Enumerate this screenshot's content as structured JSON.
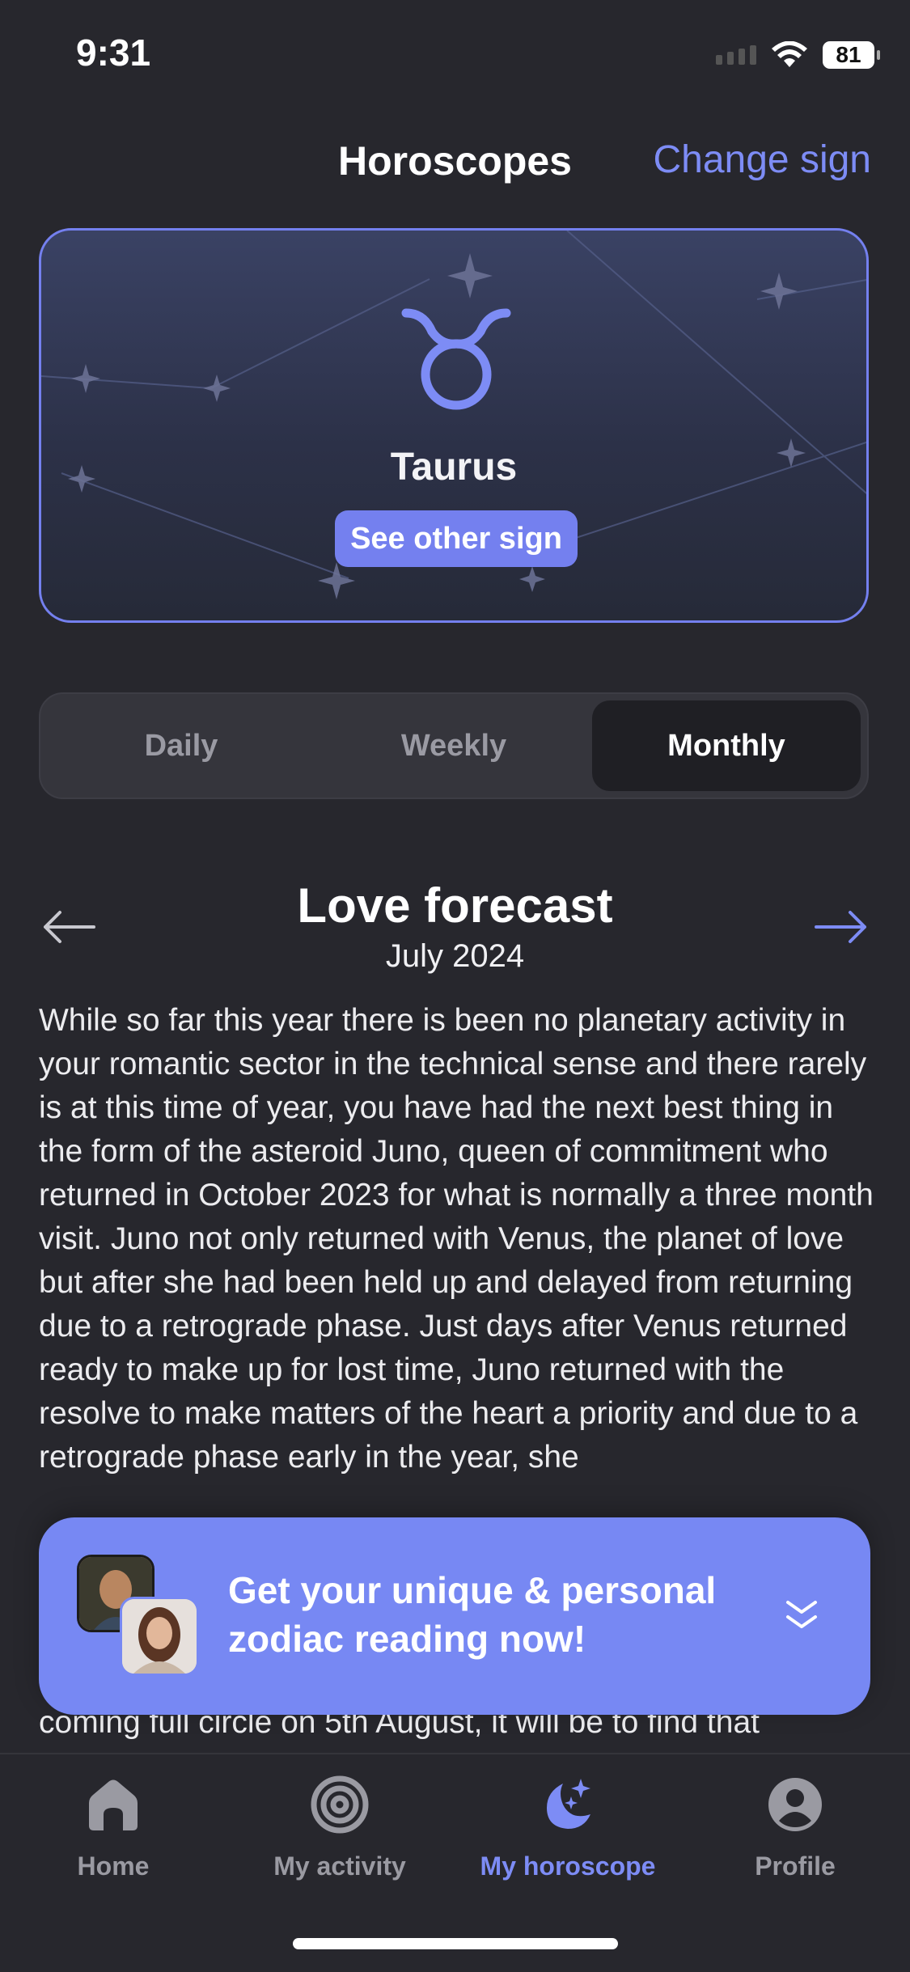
{
  "status_bar": {
    "time": "9:31",
    "battery": "81"
  },
  "header": {
    "title": "Horoscopes",
    "change_sign": "Change sign"
  },
  "sign_card": {
    "sign_name": "Taurus",
    "symbol": "taurus-icon",
    "button": "See other sign"
  },
  "period_tabs": {
    "items": [
      "Daily",
      "Weekly",
      "Monthly"
    ],
    "selected": "Monthly"
  },
  "forecast": {
    "title": "Love forecast",
    "date": "July 2024",
    "body": "While so far this year there is been no planetary activity in your romantic sector in the technical sense and there rarely is at this time of year, you have had the next best thing in the form of the asteroid Juno, queen of commitment who returned in October 2023 for what is normally a three month visit. Juno not only returned with Venus, the planet of love but after she had been held up and delayed from returning due to a retrograde phase. Just days after Venus returned ready to make up for lost time, Juno returned with the resolve to make matters of the heart a priority and due to a retrograde phase early in the year, she",
    "body_tail": "coming full circle on 5th August, it will be to find that"
  },
  "promo": {
    "text_line1": "Get your unique & personal",
    "text_line2": "zodiac reading now!"
  },
  "bottom_nav": {
    "items": [
      {
        "label": "Home",
        "icon": "home-icon"
      },
      {
        "label": "My activity",
        "icon": "spiral-icon"
      },
      {
        "label": "My horoscope",
        "icon": "moon-stars-icon"
      },
      {
        "label": "Profile",
        "icon": "profile-icon"
      }
    ],
    "active": "My horoscope"
  },
  "colors": {
    "accent": "#7480ef",
    "background": "#27272d",
    "promo": "#7788f3"
  }
}
